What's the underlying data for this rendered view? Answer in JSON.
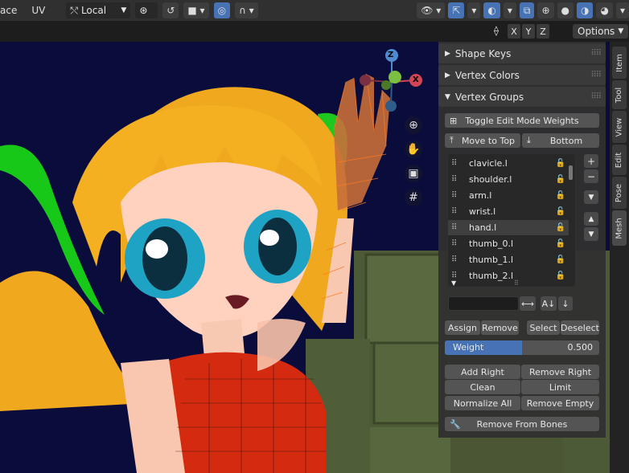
{
  "header": {
    "mode_fragment": "ace",
    "uv_menu": "UV",
    "orientation_select": "Local",
    "options_label": "Options",
    "axis_buttons": [
      "X",
      "Y",
      "Z"
    ]
  },
  "panel": {
    "shape_keys": "Shape Keys",
    "vertex_colors": "Vertex Colors",
    "vertex_groups": "Vertex Groups",
    "toggle_weights": "Toggle Edit Mode Weights",
    "move_to_top": "Move to Top",
    "bottom": "Bottom",
    "groups": [
      "clavicle.l",
      "shoulder.l",
      "arm.l",
      "wrist.l",
      "hand.l",
      "thumb_0.l",
      "thumb_1.l",
      "thumb_2.l"
    ],
    "selected_group": "hand.l",
    "assign": "Assign",
    "remove": "Remove",
    "select": "Select",
    "deselect": "Deselect",
    "weight_label": "Weight",
    "weight_value": "0.500",
    "weight_fraction": 0.5,
    "add_right": "Add Right",
    "remove_right": "Remove Right",
    "clean": "Clean",
    "limit": "Limit",
    "normalize_all": "Normalize All",
    "remove_empty": "Remove Empty",
    "remove_from_bones": "Remove From Bones"
  },
  "tabs": [
    "Item",
    "Tool",
    "View",
    "Edit",
    "Pose",
    "Mesh"
  ],
  "gizmo": {
    "x": "X",
    "z": "Z"
  },
  "colors": {
    "accent": "#4772b3",
    "panel": "#303030",
    "hair": "#f0a81e",
    "dress": "#d42a10"
  }
}
